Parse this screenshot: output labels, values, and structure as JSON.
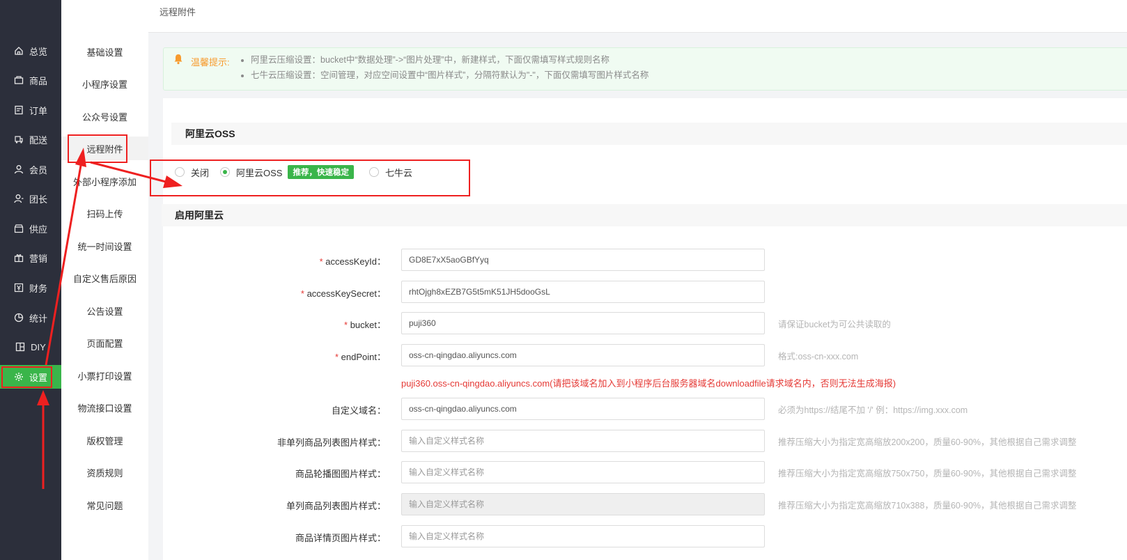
{
  "nav": {
    "items": [
      {
        "label": "总览",
        "icon": "home-icon"
      },
      {
        "label": "商品",
        "icon": "box-icon"
      },
      {
        "label": "订单",
        "icon": "order-icon"
      },
      {
        "label": "配送",
        "icon": "delivery-icon"
      },
      {
        "label": "会员",
        "icon": "user-icon"
      },
      {
        "label": "团长",
        "icon": "leader-icon"
      },
      {
        "label": "供应",
        "icon": "store-icon"
      },
      {
        "label": "营销",
        "icon": "gift-icon"
      },
      {
        "label": "财务",
        "icon": "finance-icon"
      },
      {
        "label": "统计",
        "icon": "chart-icon"
      },
      {
        "label": "DIY",
        "icon": "diy-icon"
      },
      {
        "label": "设置",
        "icon": "gear-icon"
      }
    ],
    "active": "设置"
  },
  "submenu": {
    "items": [
      "基础设置",
      "小程序设置",
      "公众号设置",
      "远程附件",
      "外部小程序添加",
      "扫码上传",
      "统一时间设置",
      "自定义售后原因",
      "公告设置",
      "页面配置",
      "小票打印设置",
      "物流接口设置",
      "版权管理",
      "资质规则",
      "常见问题"
    ],
    "active": "远程附件"
  },
  "breadcrumb": "远程附件",
  "tip": {
    "label": "温馨提示:",
    "lines": [
      "阿里云压缩设置：bucket中“数据处理”->“图片处理”中，新建样式，下面仅需填写样式规则名称",
      "七牛云压缩设置：空间管理，对应空间设置中“图片样式”，分隔符默认为\"-\"，下面仅需填写图片样式名称"
    ]
  },
  "section1": "阿里云OSS",
  "radios": {
    "off": "关闭",
    "aliyun": "阿里云OSS",
    "badge": "推荐，快速稳定",
    "qiniu": "七牛云",
    "selected": "aliyun"
  },
  "section2": "启用阿里云",
  "form": {
    "access_key_id": {
      "label": "accessKeyId：",
      "value": "GD8E7xX5aoGBfYyq"
    },
    "access_key_secret": {
      "label": "accessKeySecret：",
      "value": "rhtOjgh8xEZB7G5t5mK51JH5dooGsL"
    },
    "bucket": {
      "label": "bucket：",
      "value": "puji360",
      "hint": "请保证bucket为可公共读取的"
    },
    "endpoint": {
      "label": "endPoint：",
      "value": "oss-cn-qingdao.aliyuncs.com",
      "hint": "格式:oss-cn-xxx.com"
    },
    "warning": "puji360.oss-cn-qingdao.aliyuncs.com(请把该域名加入到小程序后台服务器域名downloadfile请求域名内，否则无法生成海报)",
    "custom_domain": {
      "label": "自定义域名：",
      "value": "oss-cn-qingdao.aliyuncs.com",
      "hint": "必须为https://结尾不加 '/' 例：https://img.xxx.com"
    },
    "list_style": {
      "label": "非单列商品列表图片样式：",
      "placeholder": "输入自定义样式名称",
      "hint": "推荐压缩大小为指定宽高缩放200x200，质量60-90%，其他根据自己需求调整"
    },
    "banner_style": {
      "label": "商品轮播图图片样式：",
      "placeholder": "输入自定义样式名称",
      "hint": "推荐压缩大小为指定宽高缩放750x750，质量60-90%，其他根据自己需求调整"
    },
    "single_style": {
      "label": "单列商品列表图片样式：",
      "placeholder": "输入自定义样式名称",
      "hint": "推荐压缩大小为指定宽高缩放710x388，质量60-90%，其他根据自己需求调整"
    },
    "detail_style": {
      "label": "商品详情页图片样式：",
      "placeholder": "输入自定义样式名称"
    }
  },
  "colors": {
    "accent": "#3ab54a",
    "nav_bg": "#2c2f3b",
    "warn": "#e53935",
    "annotation": "#ee2020"
  }
}
